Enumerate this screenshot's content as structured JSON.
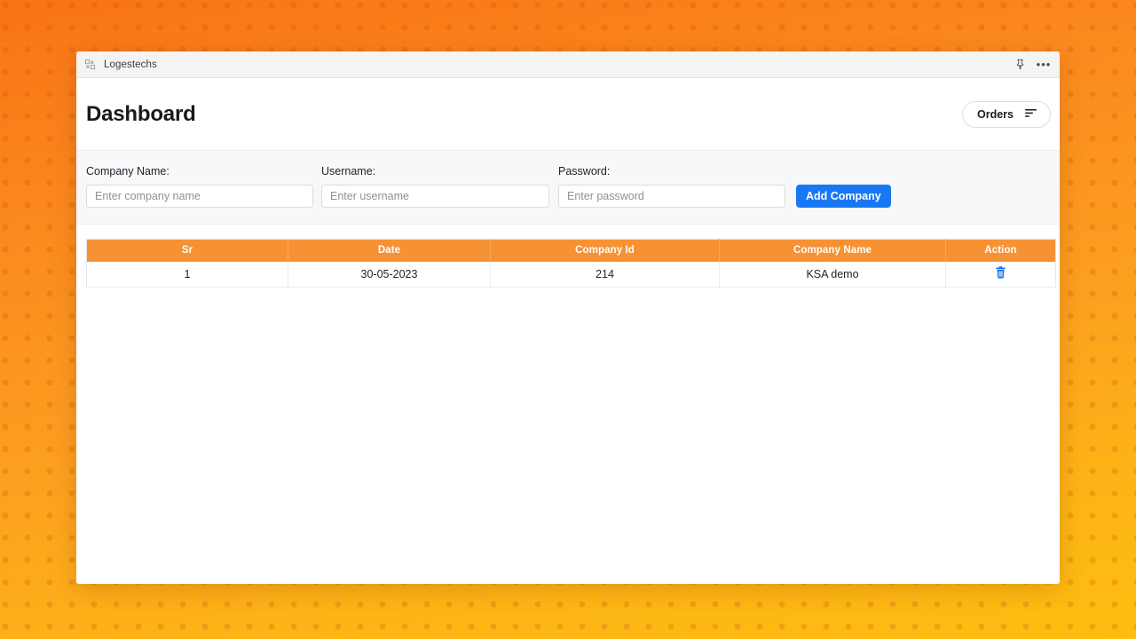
{
  "window": {
    "titlebar": {
      "favicon_name": "app-favicon-icon",
      "title": "Logestechs",
      "pin_icon": "pin-icon",
      "more_icon": "more-options-icon"
    }
  },
  "page": {
    "title": "Dashboard",
    "orders_button": {
      "label": "Orders",
      "icon": "filter-sort-icon"
    }
  },
  "form": {
    "fields": [
      {
        "label": "Company Name:",
        "placeholder": "Enter company name",
        "value": "",
        "name": "company-name-input"
      },
      {
        "label": "Username:",
        "placeholder": "Enter username",
        "value": "",
        "name": "username-input"
      },
      {
        "label": "Password:",
        "placeholder": "Enter password",
        "value": "",
        "name": "password-input"
      }
    ],
    "submit_label": "Add Company"
  },
  "table": {
    "headers": [
      "Sr",
      "Date",
      "Company Id",
      "Company Name",
      "Action"
    ],
    "rows": [
      {
        "sr": "1",
        "date": "30-05-2023",
        "company_id": "214",
        "company_name": "KSA demo",
        "action_icon": "delete-trash-icon"
      }
    ]
  },
  "colors": {
    "header_orange": "#F79234",
    "primary_blue": "#1877F2",
    "background_top": "#F97316",
    "background_bottom": "#FEBD10",
    "action_icon_blue": "#1877F2"
  }
}
